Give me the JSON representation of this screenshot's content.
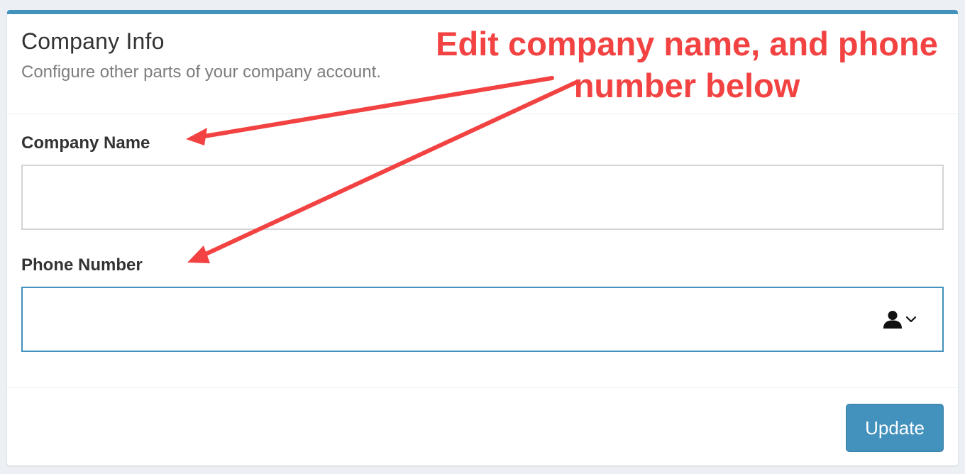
{
  "card": {
    "title": "Company Info",
    "subtitle": "Configure other parts of your company account."
  },
  "form": {
    "company_name": {
      "label": "Company Name",
      "value": ""
    },
    "phone_number": {
      "label": "Phone Number",
      "value": ""
    }
  },
  "footer": {
    "update_label": "Update"
  },
  "annotation": {
    "line1": "Edit company name, and phone",
    "line2": "number below"
  },
  "icons": {
    "contact_picker": "person-icon",
    "dropdown": "chevron-down-icon"
  },
  "colors": {
    "accent": "#4391bd",
    "annotation": "#f24242",
    "background": "#ecf0f5"
  }
}
